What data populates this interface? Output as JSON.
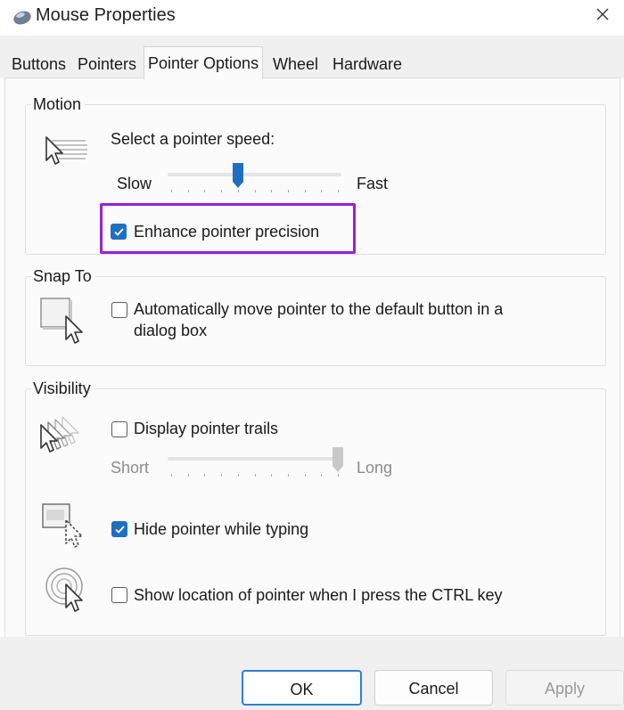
{
  "window": {
    "title": "Mouse Properties",
    "icon": "mouse-icon"
  },
  "tabs": [
    {
      "label": "Buttons",
      "active": false
    },
    {
      "label": "Pointers",
      "active": false
    },
    {
      "label": "Pointer Options",
      "active": true
    },
    {
      "label": "Wheel",
      "active": false
    },
    {
      "label": "Hardware",
      "active": false
    }
  ],
  "motion": {
    "legend": "Motion",
    "speed_label": "Select a pointer speed:",
    "slow_label": "Slow",
    "fast_label": "Fast",
    "speed_value": 0.4,
    "enhance_precision": {
      "label": "Enhance pointer precision",
      "checked": true
    }
  },
  "snap_to": {
    "legend": "Snap To",
    "auto_move": {
      "label_line1": "Automatically move pointer to the default button in a",
      "label_line2": "dialog box",
      "checked": false
    }
  },
  "visibility": {
    "legend": "Visibility",
    "trails": {
      "label": "Display pointer trails",
      "checked": false
    },
    "short_label": "Short",
    "long_label": "Long",
    "trail_value": 1.0,
    "hide_typing": {
      "label": "Hide pointer while typing",
      "checked": true
    },
    "show_location": {
      "label": "Show location of pointer when I press the CTRL key",
      "checked": false
    }
  },
  "buttons": {
    "ok": "OK",
    "cancel": "Cancel",
    "apply": "Apply"
  },
  "colors": {
    "accent": "#1f6fc1",
    "highlight": "#9b1fd8",
    "ok_border": "#2f7fd3"
  }
}
